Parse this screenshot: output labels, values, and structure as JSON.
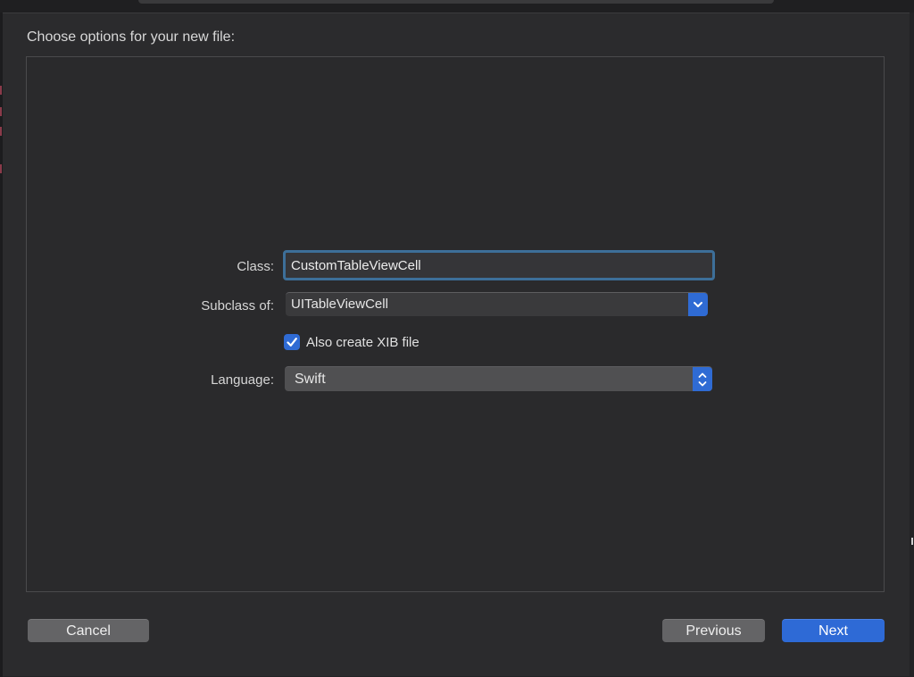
{
  "dialog": {
    "title": "Choose options for your new file:"
  },
  "form": {
    "class": {
      "label": "Class:",
      "value": "CustomTableViewCell"
    },
    "subclass": {
      "label": "Subclass of:",
      "value": "UITableViewCell",
      "icon": "chevron-down-icon"
    },
    "xib": {
      "label": "Also create XIB file",
      "checked": true,
      "icon": "checkmark-icon"
    },
    "language": {
      "label": "Language:",
      "value": "Swift",
      "icon": "up-down-chevron-icon"
    }
  },
  "buttons": {
    "cancel": "Cancel",
    "previous": "Previous",
    "next": "Next"
  },
  "colors": {
    "accent": "#2e6ad6",
    "focus_ring": "#3d6f99",
    "sheet_background": "#2b2b2d"
  }
}
